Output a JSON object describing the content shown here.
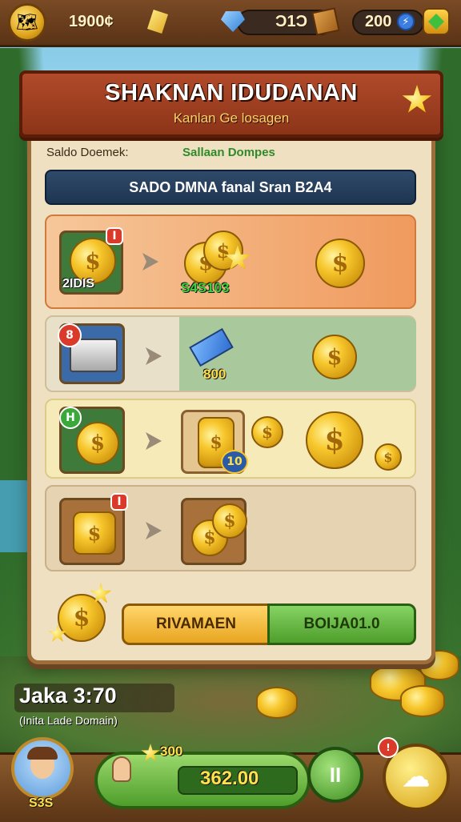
{
  "topbar": {
    "coins": "1900¢",
    "energy": "Ɔ1Ɔ",
    "gems": "200",
    "bolt_glyph": "⚡"
  },
  "banner": {
    "title": "SHAKNAN IDUDANAN",
    "subtitle": "Kanlan Ge losagen"
  },
  "labels": {
    "left": "Saldo Doemek:",
    "right": "Sallaan Dompes"
  },
  "search": {
    "text": "SADO DMNA  fanal Sran B2A4"
  },
  "rows": [
    {
      "badge": "I",
      "source_value": "2IDIS",
      "reward_value": "S4S103"
    },
    {
      "badge": "8",
      "reward_value": "800"
    },
    {
      "badge": "H",
      "reward_value": "10"
    },
    {
      "badge": "I"
    }
  ],
  "actions": {
    "left_label": "RIVAMAEN",
    "right_label": "BOIJA01.0"
  },
  "timer": {
    "value": "Jaka 3:70",
    "caption": "(Inita Lade Domain)"
  },
  "bottombar": {
    "player_score": "S3S",
    "bonus_stars": "300",
    "balance": "362.00",
    "pause_glyph": "II"
  },
  "colors": {
    "banner": "#a0401f",
    "orange_row": "#f1a36c",
    "green_row": "#a7c79a",
    "yellow_row": "#f4e4a8",
    "tan_row": "#e4cfad",
    "action_left": "#f2b837",
    "action_right": "#5fb33d"
  }
}
